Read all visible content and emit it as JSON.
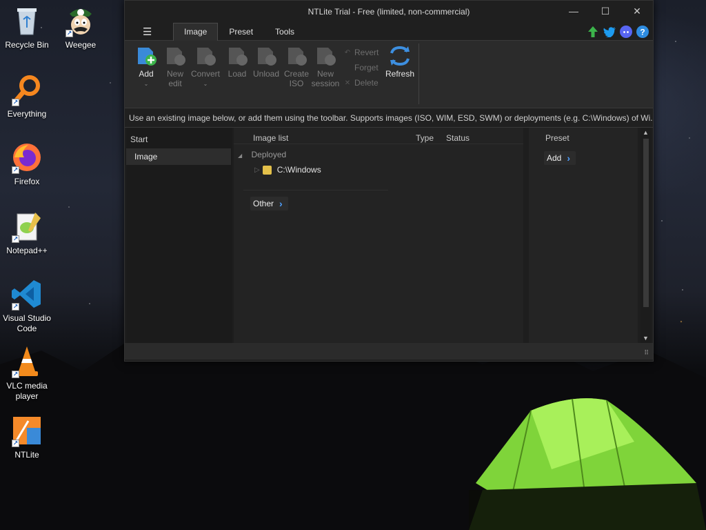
{
  "desktop": {
    "icons": [
      {
        "label": "Recycle Bin",
        "icon": "recycle-bin-icon"
      },
      {
        "label": "Weegee",
        "icon": "weegee-icon"
      },
      {
        "label": "Everything",
        "icon": "magnifier-icon"
      },
      {
        "label": "Firefox",
        "icon": "firefox-icon"
      },
      {
        "label": "Notepad++",
        "icon": "notepadpp-icon"
      },
      {
        "label": "Visual Studio Code",
        "icon": "vscode-icon"
      },
      {
        "label": "VLC media player",
        "icon": "vlc-cone-icon"
      },
      {
        "label": "NTLite",
        "icon": "ntlite-icon"
      }
    ]
  },
  "window": {
    "title": "NTLite Trial - Free (limited, non-commercial)",
    "controls": {
      "minimize": "—",
      "maximize": "☐",
      "close": "✕"
    }
  },
  "menubar": {
    "hamburger": "☰",
    "tabs": [
      {
        "label": "Image",
        "active": true
      },
      {
        "label": "Preset",
        "active": false
      },
      {
        "label": "Tools",
        "active": false
      }
    ],
    "top_icons": [
      "update-arrow-icon",
      "twitter-icon",
      "discord-icon",
      "help-icon"
    ]
  },
  "toolbar": {
    "add": {
      "label": "Add",
      "caret": "⌄"
    },
    "new_edit": {
      "label_1": "New",
      "label_2": "edit"
    },
    "convert": {
      "label": "Convert",
      "caret": "⌄"
    },
    "load": {
      "label": "Load"
    },
    "unload": {
      "label": "Unload"
    },
    "create_iso": {
      "label_1": "Create",
      "label_2": "ISO"
    },
    "new_session": {
      "label_1": "New",
      "label_2": "session"
    },
    "revert": "Revert",
    "forget": "Forget",
    "delete": "Delete",
    "refresh": {
      "label": "Refresh"
    }
  },
  "info_bar": {
    "text": "Use an existing image below, or add them using the toolbar. Supports images (ISO, WIM, ESD, SWM) or deployments (e.g. C:\\Windows) of Wi..."
  },
  "left_panel": {
    "header": "Start",
    "item": "Image"
  },
  "image_list": {
    "columns": {
      "name": "Image list",
      "type": "Type",
      "status": "Status"
    },
    "group": "Deployed",
    "rows": [
      {
        "path": "C:\\Windows"
      }
    ],
    "other_button": "Other",
    "chevron": "›"
  },
  "preset_panel": {
    "header": "Preset",
    "add_button": "Add"
  },
  "colors": {
    "accent_blue": "#4ea0ff",
    "window_bg": "#1f1f1f",
    "toolbar_bg": "#2b2b2b",
    "add_green": "#3cb44b",
    "refresh_blue": "#3d8fe0",
    "tent_green": "#8fe03a"
  }
}
